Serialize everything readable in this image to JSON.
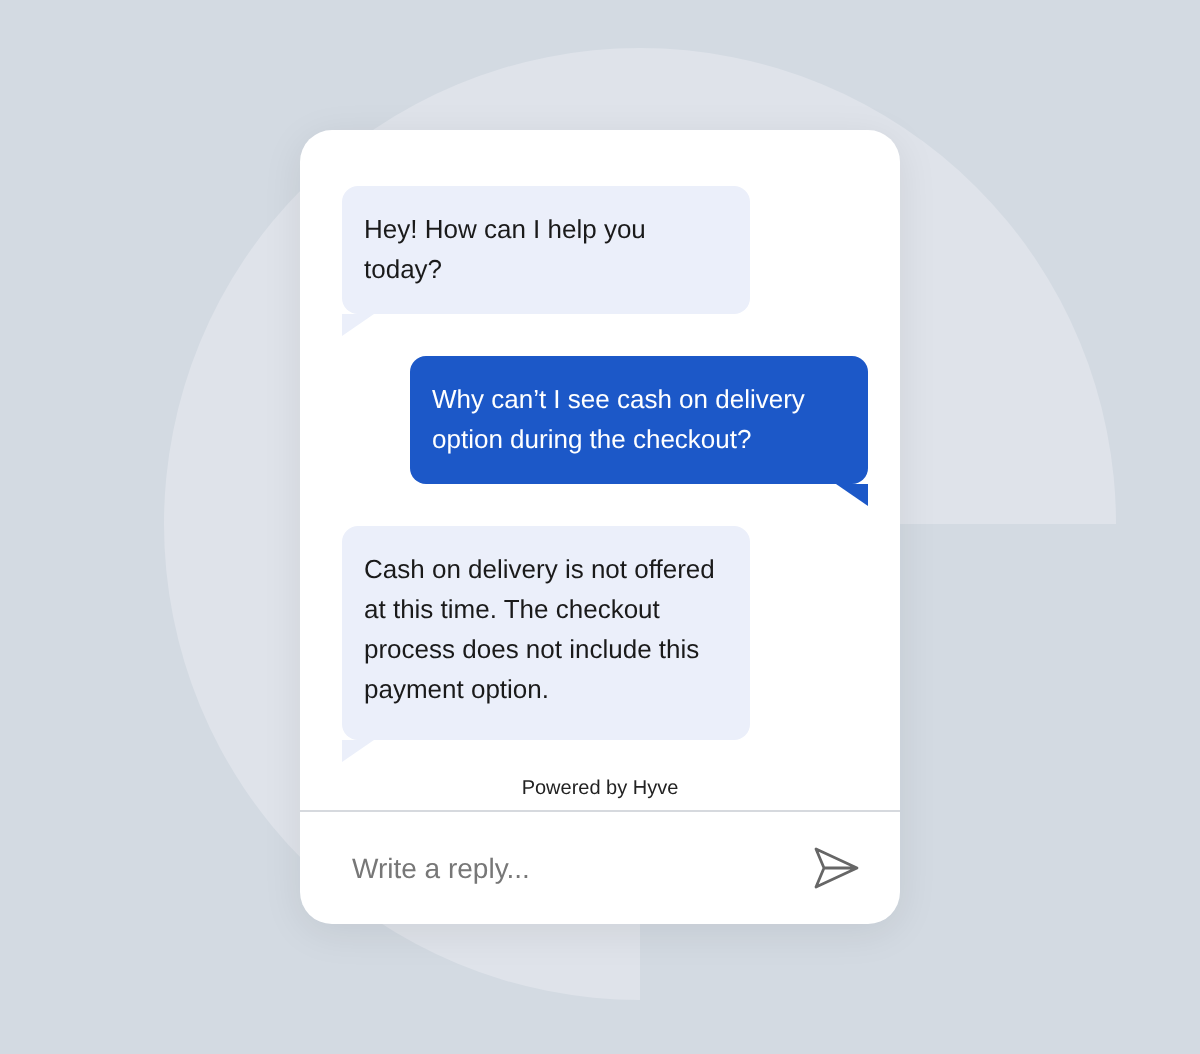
{
  "messages": [
    {
      "kind": "bot",
      "text": "Hey! How can I help you today?"
    },
    {
      "kind": "user",
      "text": "Why can’t I see cash on delivery option during the checkout?"
    },
    {
      "kind": "bot",
      "text": "Cash on delivery is not offered at this time. The checkout process does not include this payment option."
    }
  ],
  "footer": "Powered by Hyve",
  "reply": {
    "placeholder": "Write a reply..."
  }
}
